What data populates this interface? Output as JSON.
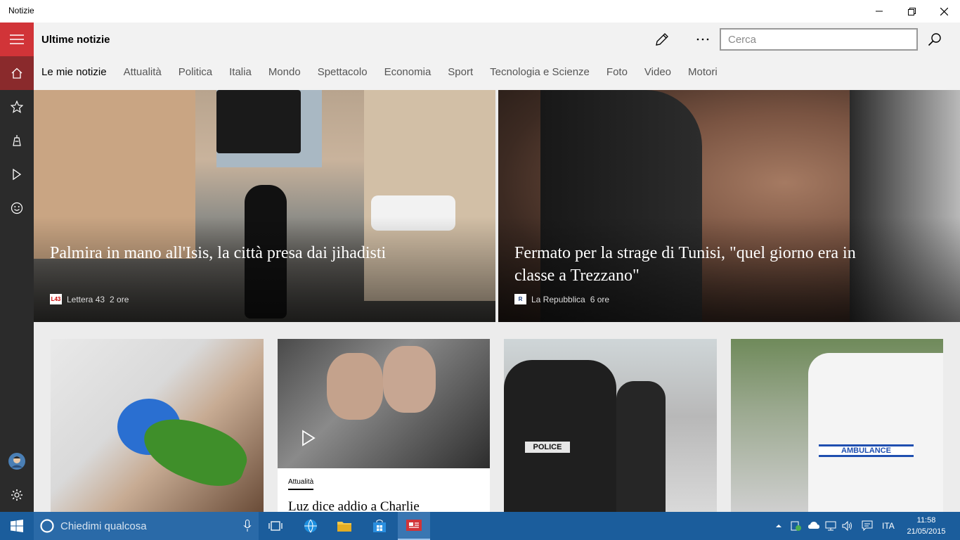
{
  "window": {
    "title": "Notizie",
    "minimize_icon": "minimize-icon",
    "maximize_icon": "restore-icon",
    "close_icon": "close-icon"
  },
  "rail": {
    "items": [
      {
        "name": "hamburger-menu",
        "icon": "hamburger-icon"
      },
      {
        "name": "home",
        "icon": "home-icon"
      },
      {
        "name": "interests",
        "icon": "star-icon"
      },
      {
        "name": "local",
        "icon": "local-icon"
      },
      {
        "name": "videos",
        "icon": "play-icon"
      },
      {
        "name": "feedback",
        "icon": "smiley-icon"
      },
      {
        "name": "account",
        "icon": "avatar-icon"
      },
      {
        "name": "settings",
        "icon": "gear-icon"
      }
    ],
    "accent": "#d13438"
  },
  "header": {
    "title": "Ultime notizie",
    "edit_icon": "pencil-icon",
    "more_icon": "more-icon",
    "search_placeholder": "Cerca",
    "search_icon": "search-icon"
  },
  "tabs": [
    {
      "label": "Le mie notizie",
      "active": true
    },
    {
      "label": "Attualità"
    },
    {
      "label": "Politica"
    },
    {
      "label": "Italia"
    },
    {
      "label": "Mondo"
    },
    {
      "label": "Spettacolo"
    },
    {
      "label": "Economia"
    },
    {
      "label": "Sport"
    },
    {
      "label": "Tecnologia e Scienze"
    },
    {
      "label": "Foto"
    },
    {
      "label": "Video"
    },
    {
      "label": "Motori"
    }
  ],
  "hero": [
    {
      "title": "Palmira in mano all'Isis, la città presa dai jihadisti",
      "source": "Lettera 43",
      "age": "2 ore"
    },
    {
      "title": "Fermato per la strage di Tunisi, \"quel giorno era in classe a Trezzano\"",
      "source": "La Repubblica",
      "age": "6 ore"
    }
  ],
  "cards": [
    {
      "category": "",
      "title": ""
    },
    {
      "category": "Attualità",
      "title": "Luz dice addio a Charlie",
      "play_icon": "play-icon"
    },
    {
      "category": "",
      "title": ""
    },
    {
      "category": "",
      "title": ""
    }
  ],
  "taskbar": {
    "start_icon": "windows-logo-icon",
    "cortana_placeholder": "Chiedimi qualcosa",
    "mic_icon": "microphone-icon",
    "task_view_icon": "task-view-icon",
    "pinned": [
      "edge-icon",
      "file-explorer-icon",
      "store-icon",
      "news-app-icon"
    ],
    "tray": {
      "language": "ITA",
      "time": "11:58",
      "date": "21/05/2015"
    },
    "color": "#1b5d9c"
  }
}
